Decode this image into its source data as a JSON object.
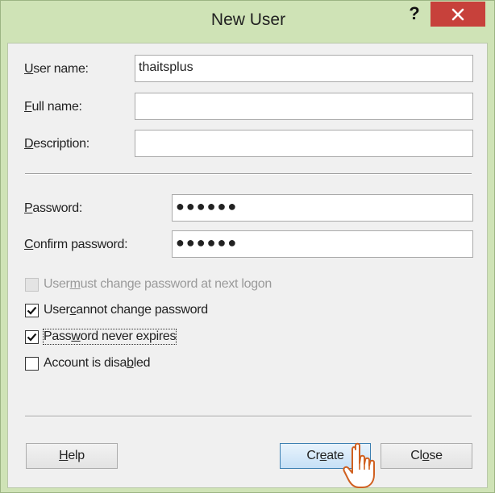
{
  "window": {
    "title": "New User",
    "help_glyph": "?",
    "close_glyph": "✕"
  },
  "form": {
    "user_name": {
      "label_mnemonic": "U",
      "label_rest": "ser name:",
      "value": "thaitsplus"
    },
    "full_name": {
      "label_mnemonic": "F",
      "label_rest": "ull name:",
      "value": ""
    },
    "description": {
      "label_mnemonic": "D",
      "label_rest": "escription:",
      "value": ""
    },
    "password": {
      "label_mnemonic": "P",
      "label_rest": "assword:",
      "value": "●●●●●●"
    },
    "confirm_password": {
      "label_mnemonic": "C",
      "label_rest": "onfirm password:",
      "value": "●●●●●●"
    }
  },
  "options": {
    "must_change": {
      "pre": "User ",
      "mnemonic": "m",
      "post": "ust change password at next logon",
      "checked": false,
      "disabled": true
    },
    "cannot_change": {
      "pre": "User ",
      "mnemonic": "c",
      "post": "annot change password",
      "checked": true,
      "disabled": false
    },
    "never_expires": {
      "pre": "Pass",
      "mnemonic": "w",
      "post": "ord never expires",
      "checked": true,
      "disabled": false
    },
    "disabled": {
      "pre": "Account is disa",
      "mnemonic": "b",
      "post": "led",
      "checked": false,
      "disabled": false
    }
  },
  "buttons": {
    "help": {
      "mnemonic": "H",
      "rest": "elp"
    },
    "create": {
      "pre": "Cr",
      "mnemonic": "e",
      "post": "ate"
    },
    "close": {
      "pre": "Cl",
      "mnemonic": "o",
      "post": "se"
    }
  },
  "icons": {
    "close": "close-icon",
    "checkmark": "checkmark-icon",
    "cursor": "hand-pointer-icon"
  },
  "colors": {
    "frame": "#cfe3b6",
    "close_button": "#c7413b",
    "client": "#f0f0f0",
    "default_button_border": "#3c7fb1"
  }
}
